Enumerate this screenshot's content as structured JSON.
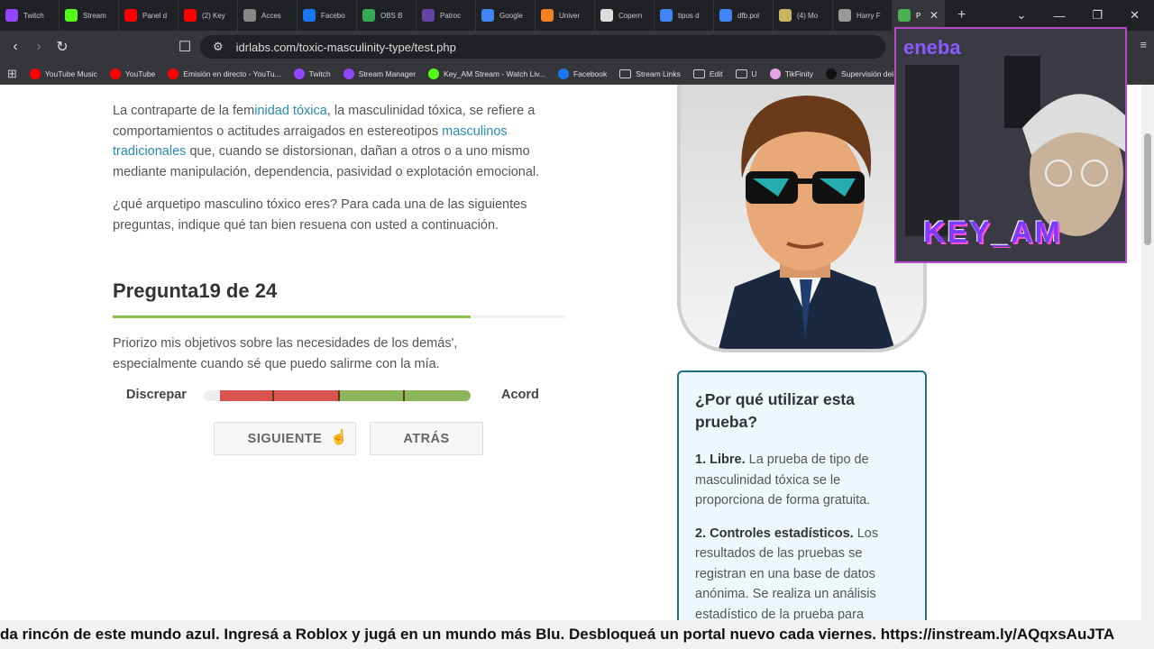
{
  "browser": {
    "tabs": [
      {
        "title": "Twitch",
        "color": "#9146ff"
      },
      {
        "title": "Stream",
        "color": "#53fc18"
      },
      {
        "title": "Panel d",
        "color": "#ff0000"
      },
      {
        "title": "(2) Key",
        "color": "#ff0000"
      },
      {
        "title": "Acces",
        "color": "#888888"
      },
      {
        "title": "Facebo",
        "color": "#1877f2"
      },
      {
        "title": "OBS B",
        "color": "#34a853"
      },
      {
        "title": "Patroc",
        "color": "#6441a5"
      },
      {
        "title": "Google",
        "color": "#4285f4"
      },
      {
        "title": "Univer",
        "color": "#f48024"
      },
      {
        "title": "Copern",
        "color": "#dddddd"
      },
      {
        "title": "tipos d",
        "color": "#4285f4"
      },
      {
        "title": "dfb.pol",
        "color": "#4285f4"
      },
      {
        "title": "(4) Mo",
        "color": "#c8b560"
      },
      {
        "title": "Harry F",
        "color": "#999999"
      },
      {
        "title": "P",
        "color": "#4caf50"
      }
    ],
    "url": "idrlabs.com/toxic-masculinity-type/test.php",
    "bookmarks": [
      {
        "label": "YouTube Music",
        "color": "#ff0000"
      },
      {
        "label": "YouTube",
        "color": "#ff0000"
      },
      {
        "label": "Emisión en directo - YouTu...",
        "color": "#ff0000"
      },
      {
        "label": "Twitch",
        "color": "#9146ff"
      },
      {
        "label": "Stream Manager",
        "color": "#9146ff"
      },
      {
        "label": "Key_AM Stream - Watch Liv...",
        "color": "#53fc18"
      },
      {
        "label": "Facebook",
        "color": "#1877f2"
      },
      {
        "label": "Stream Links",
        "folder": true
      },
      {
        "label": "Edit",
        "folder": true
      },
      {
        "label": "U",
        "folder": true
      },
      {
        "label": "TikFinity",
        "color": "#e8a2e8"
      },
      {
        "label": "Supervisión del U",
        "color": "#111111"
      }
    ]
  },
  "intro": {
    "p1_a": "La contraparte de la fem",
    "p1_link1": "inidad tóxica",
    "p1_b": ", la masculinidad tóxica, se refiere a comportamientos o actitudes arraigados en estereotipos ",
    "p1_link2": "masculinos tradicionales",
    "p1_c": " que, cuando se distorsionan, dañan a otros o a uno mismo mediante manipulación, dependencia, pasividad o explotación emocional.",
    "p2": "¿qué arquetipo masculino tóxico eres? Para cada una de las siguientes preguntas, indique qué tan bien resuena con usted a continuación."
  },
  "question": {
    "title": "Pregunta19 de 24",
    "progress": 0.79,
    "text": "Priorizo mis objetivos sobre las necesidades de los demás', especialmente cuando sé que puedo salirme con la mía.",
    "scale_left": "Discrepar",
    "scale_right": "Acord",
    "next_label": "SIGUIENTE",
    "back_label": "ATRÁS"
  },
  "sidebar": {
    "heading": "¿Por qué utilizar esta prueba?",
    "items": [
      {
        "bold": "1. Libre.",
        "text": " La prueba de tipo de masculinidad tóxica se le proporciona de forma gratuita."
      },
      {
        "bold": "2. Controles estadísticos.",
        "text": " Los resultados de las pruebas se registran en una base de datos anónima. Se realiza un análisis estadístico de la prueba para"
      }
    ]
  },
  "overlay": {
    "sponsor": "eneba",
    "name": "KEY_AM",
    "ticker": "da rincón de este mundo azul. Ingresá a Roblox y jugá en un mundo más Blu. Desbloqueá un portal nuevo cada viernes. https://instream.ly/AQqxsAuJTA"
  },
  "colors": {
    "link": "#2a8ab4",
    "progress": "#8bc34a",
    "scale_disagree": "#d9534f",
    "scale_agree": "#8db55a",
    "card_border": "#1f6e86"
  }
}
